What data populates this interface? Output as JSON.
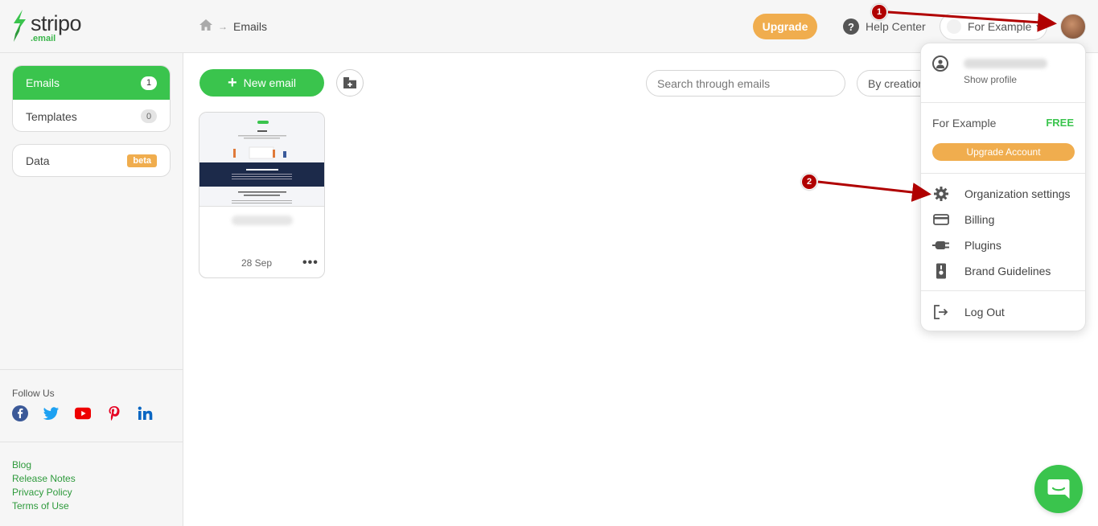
{
  "brand": {
    "name": "stripo",
    "suffix": ".email",
    "accent": "#3ac44d",
    "orange": "#f0ad4e"
  },
  "header": {
    "breadcrumb": {
      "home_icon": "home-icon",
      "current": "Emails"
    },
    "upgrade_label": "Upgrade",
    "help_label": "Help Center",
    "org_label": "For Example"
  },
  "sidebar": {
    "nav": [
      {
        "label": "Emails",
        "count": "1",
        "active": true
      },
      {
        "label": "Templates",
        "count": "0",
        "active": false
      }
    ],
    "data_label": "Data",
    "data_badge": "beta",
    "follow_label": "Follow Us",
    "socials": [
      "facebook-icon",
      "twitter-icon",
      "youtube-icon",
      "pinterest-icon",
      "linkedin-icon"
    ],
    "links": [
      "Blog",
      "Release Notes",
      "Privacy Policy",
      "Terms of Use"
    ]
  },
  "main": {
    "new_email_label": "New email",
    "search_placeholder": "Search through emails",
    "sort_label": "By creation",
    "emails": [
      {
        "date": "28 Sep"
      }
    ]
  },
  "dropdown": {
    "show_profile": "Show profile",
    "org_name": "For Example",
    "plan": "FREE",
    "upgrade_account": "Upgrade Account",
    "items": [
      "Organization settings",
      "Billing",
      "Plugins",
      "Brand Guidelines"
    ],
    "logout": "Log Out"
  },
  "annotations": {
    "marker1": "1",
    "marker2": "2",
    "color": "#b00000"
  }
}
